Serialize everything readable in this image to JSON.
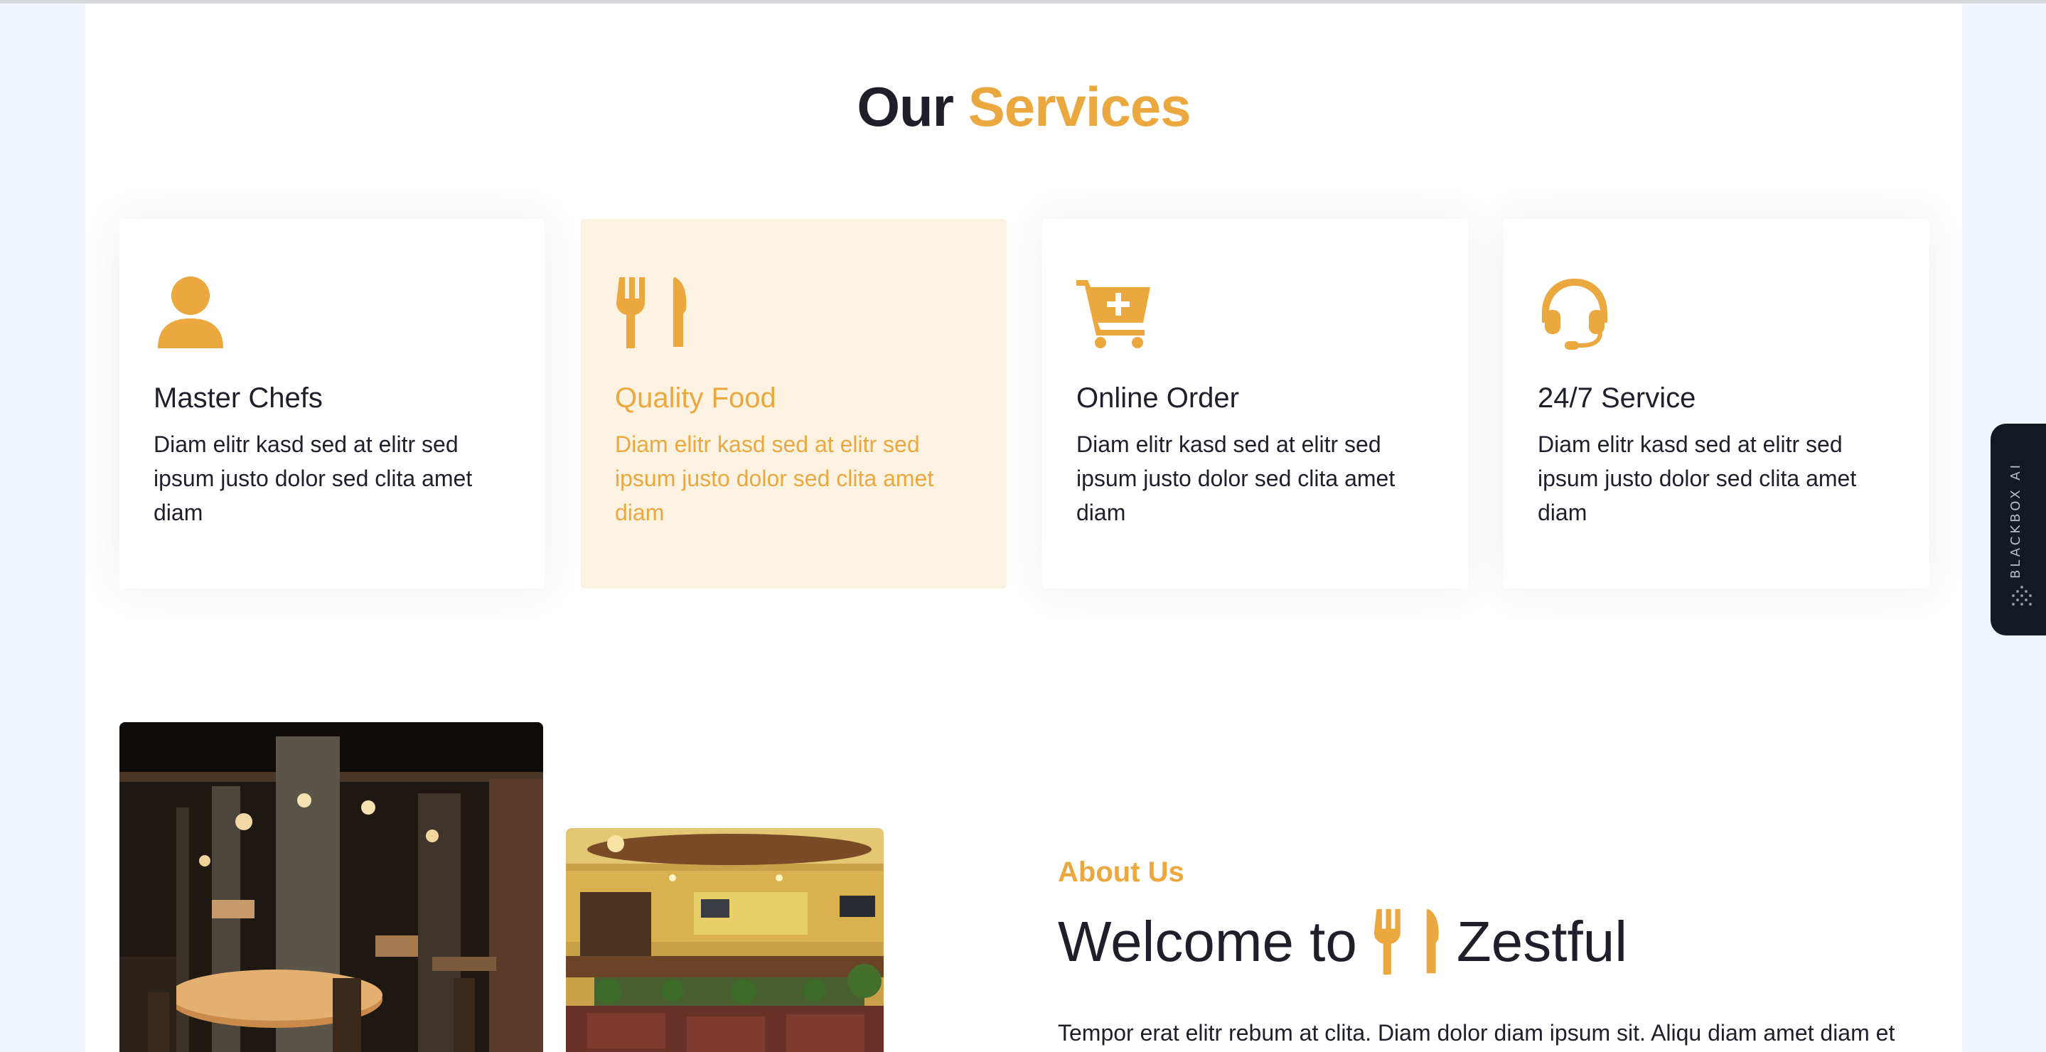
{
  "services": {
    "title_prefix": "Our",
    "title_accent": "Services",
    "cards": [
      {
        "icon": "user-icon",
        "title": "Master Chefs",
        "desc": "Diam elitr kasd sed at elitr sed ipsum justo dolor sed clita amet diam",
        "active": false
      },
      {
        "icon": "utensils-icon",
        "title": "Quality Food",
        "desc": "Diam elitr kasd sed at elitr sed ipsum justo dolor sed clita amet diam",
        "active": true
      },
      {
        "icon": "cart-plus-icon",
        "title": "Online Order",
        "desc": "Diam elitr kasd sed at elitr sed ipsum justo dolor sed clita amet diam",
        "active": false
      },
      {
        "icon": "headset-icon",
        "title": "24/7 Service",
        "desc": "Diam elitr kasd sed at elitr sed ipsum justo dolor sed clita amet diam",
        "active": false
      }
    ]
  },
  "about": {
    "label": "About Us",
    "heading_before": "Welcome to",
    "heading_icon": "utensils-icon",
    "heading_after": "Zestful",
    "text": "Tempor erat elitr rebum at clita. Diam dolor diam ipsum sit. Aliqu diam amet diam et"
  },
  "side_widget": {
    "label": "BLACKBOX AI"
  },
  "colors": {
    "accent": "#eaa83f",
    "active_card_bg": "#fbf2e2",
    "dark_text": "#1f1f2b"
  }
}
